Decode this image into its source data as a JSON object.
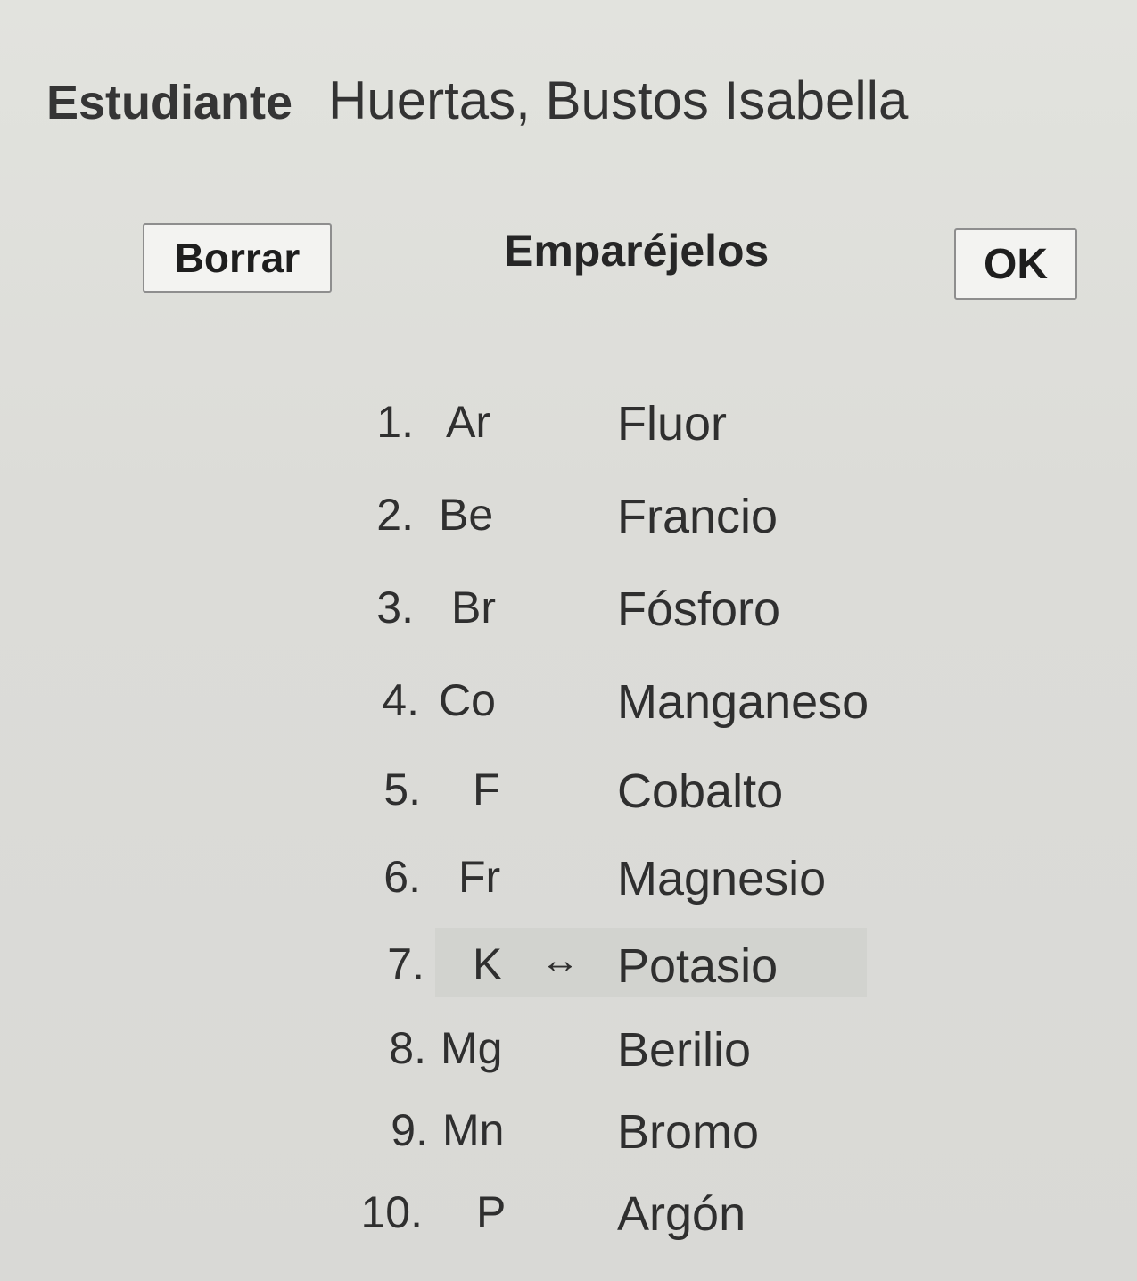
{
  "header": {
    "label": "Estudiante",
    "student_name": "Huertas, Bustos Isabella"
  },
  "toolbar": {
    "clear_label": "Borrar",
    "instruction": "Emparéjelos",
    "ok_label": "OK"
  },
  "matching": {
    "items": [
      {
        "number": "1.",
        "symbol": "Ar",
        "name": "Fluor",
        "connector": ""
      },
      {
        "number": "2.",
        "symbol": "Be",
        "name": "Francio",
        "connector": ""
      },
      {
        "number": "3.",
        "symbol": "Br",
        "name": "Fósforo",
        "connector": ""
      },
      {
        "number": "4.",
        "symbol": "Co",
        "name": "Manganeso",
        "connector": ""
      },
      {
        "number": "5.",
        "symbol": "F",
        "name": "Cobalto",
        "connector": ""
      },
      {
        "number": "6.",
        "symbol": "Fr",
        "name": "Magnesio",
        "connector": ""
      },
      {
        "number": "7.",
        "symbol": "K",
        "name": "Potasio",
        "connector": "↔"
      },
      {
        "number": "8.",
        "symbol": "Mg",
        "name": "Berilio",
        "connector": ""
      },
      {
        "number": "9.",
        "symbol": "Mn",
        "name": "Bromo",
        "connector": ""
      },
      {
        "number": "10.",
        "symbol": "P",
        "name": "Argón",
        "connector": ""
      }
    ]
  }
}
